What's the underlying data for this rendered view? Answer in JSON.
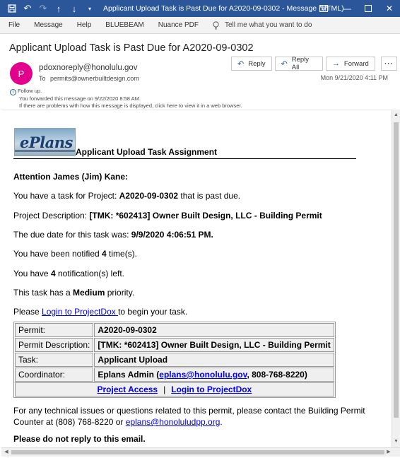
{
  "window": {
    "title": "Applicant Upload Task is Past Due for A2020-09-0302  -  Message (HTML)"
  },
  "ribbon": {
    "tabs": [
      "File",
      "Message",
      "Help",
      "BLUEBEAM",
      "Nuance PDF"
    ],
    "tell_me": "Tell me what you want to do"
  },
  "header": {
    "subject": "Applicant Upload Task is Past Due for A2020-09-0302",
    "avatar_initial": "P",
    "sender": "pdoxnoreply@honolulu.gov",
    "to_label": "To",
    "to": "permits@ownerbuiltdesign.com",
    "date": "Mon 9/21/2020 4:11 PM",
    "reply": "Reply",
    "reply_all": "Reply All",
    "forward": "Forward",
    "more": "···"
  },
  "info_bar": {
    "line1": "Follow up.",
    "line2": "You forwarded this message on 9/22/2020 8:58 AM.",
    "line3": "If there are problems with how this message is displayed, click here to view it in a web browser."
  },
  "email": {
    "logo_text": "ePlans",
    "banner_title": "Applicant Upload Task Assignment",
    "attention": "Attention James (Jim) Kane:",
    "task_pre": "You have a task for Project: ",
    "task_project": "A2020-09-0302",
    "task_post": " that is past due.",
    "desc_pre": "Project Description: ",
    "desc_value": "[TMK: *602413] Owner Built Design, LLC - Building Permit",
    "due_pre": "The due date for this task was: ",
    "due_value": "9/9/2020 4:06:51 PM.",
    "notified_pre": "You have been notified ",
    "notified_count": "4",
    "notified_post": " time(s).",
    "left_pre": "You have ",
    "left_count": "4",
    "left_post": " notification(s) left.",
    "priority_pre": "This task has a ",
    "priority_value": "Medium",
    "priority_post": " priority.",
    "login_pre": "Please ",
    "login_link": "Login to ProjectDox ",
    "login_post": "to begin your task.",
    "table": {
      "permit_label": "Permit:",
      "permit_value": "A2020-09-0302",
      "desc_label": "Permit Description:",
      "desc_value": "[TMK: *602413] Owner Built Design, LLC - Building Permit",
      "task_label": "Task:",
      "task_value": "Applicant Upload",
      "coord_label": "Coordinator:",
      "coord_pre": "Eplans Admin (",
      "coord_email": "eplans@honolulu.gov",
      "coord_post": ", 808-768-8220)",
      "project_access": "Project Access",
      "separator": "|",
      "login_link": "Login to ProjectDox"
    },
    "support_line1": "For any technical issues or questions related to this permit, please contact the Building Permit",
    "support_line2_pre": "Counter at (808) 768-8220 or ",
    "support_email": "eplans@honoluludpp.org",
    "support_line2_post": ".",
    "no_reply": "Please do not reply to this email."
  }
}
